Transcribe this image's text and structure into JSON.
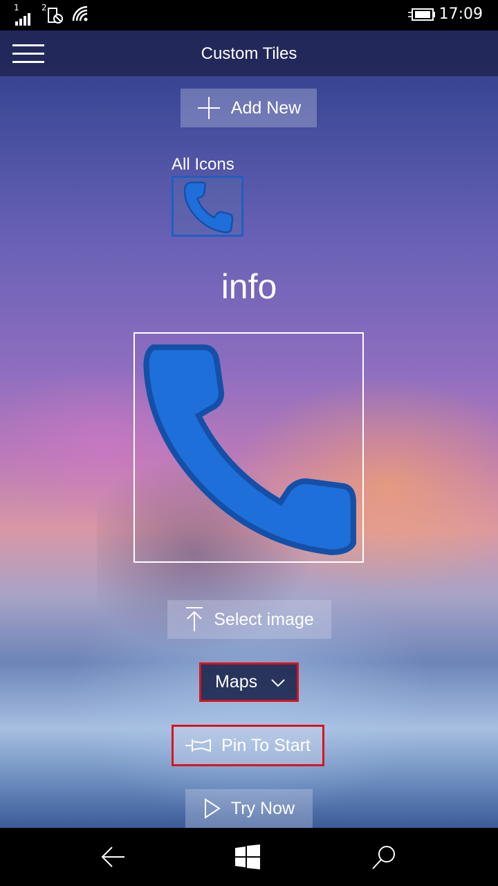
{
  "status": {
    "sim1": "1",
    "sim2": "2",
    "time": "17:09"
  },
  "header": {
    "title": "Custom Tiles"
  },
  "actions": {
    "add_new": "Add New",
    "select_image": "Select image",
    "pin_to_start": "Pin To Start",
    "try_now": "Try Now"
  },
  "icons_section": {
    "label": "All Icons"
  },
  "tile": {
    "name": "info"
  },
  "app_select": {
    "selected": "Maps"
  },
  "colors": {
    "accent_blue": "#1f5fbf",
    "highlight_red": "#d8141c",
    "phone_blue": "#1e6fd9"
  }
}
